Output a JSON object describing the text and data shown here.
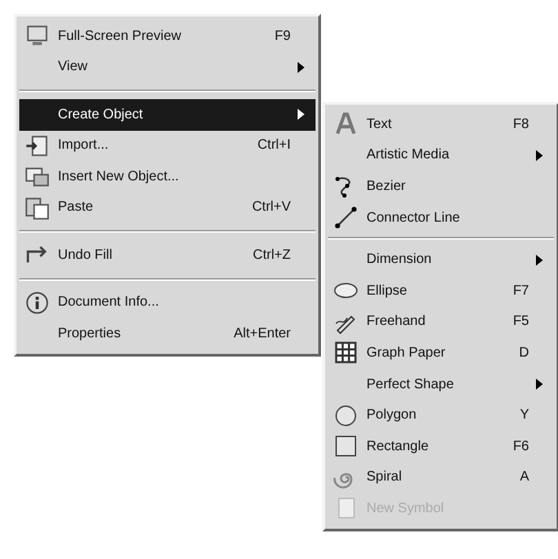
{
  "menu": {
    "items": [
      {
        "kind": "item",
        "label": "Full-Screen Preview",
        "shortcut": "F9",
        "submenu": false,
        "selected": false,
        "disabled": false
      },
      {
        "kind": "item",
        "label": "View",
        "submenu": true,
        "selected": false,
        "disabled": false
      },
      {
        "kind": "separator"
      },
      {
        "kind": "item",
        "label": "Create Object",
        "submenu": true,
        "selected": true,
        "disabled": false
      },
      {
        "kind": "item",
        "label": "Import...",
        "shortcut": "Ctrl+I",
        "submenu": false,
        "selected": false,
        "disabled": false
      },
      {
        "kind": "item",
        "label": "Insert New Object...",
        "submenu": false,
        "selected": false,
        "disabled": false
      },
      {
        "kind": "item",
        "label": "Paste",
        "shortcut": "Ctrl+V",
        "submenu": false,
        "selected": false,
        "disabled": false
      },
      {
        "kind": "separator"
      },
      {
        "kind": "item",
        "label": "Undo Fill",
        "shortcut": "Ctrl+Z",
        "submenu": false,
        "selected": false,
        "disabled": false
      },
      {
        "kind": "separator"
      },
      {
        "kind": "item",
        "label": "Document Info...",
        "submenu": false,
        "selected": false,
        "disabled": false
      },
      {
        "kind": "item",
        "label": "Properties",
        "shortcut": "Alt+Enter",
        "submenu": false,
        "selected": false,
        "disabled": false
      }
    ]
  },
  "submenu": {
    "items": [
      {
        "kind": "item",
        "label": "Text",
        "shortcut": "F8",
        "submenu": false,
        "disabled": false
      },
      {
        "kind": "item",
        "label": "Artistic Media",
        "submenu": true,
        "disabled": false
      },
      {
        "kind": "item",
        "label": "Bezier",
        "submenu": false,
        "disabled": false
      },
      {
        "kind": "item",
        "label": "Connector Line",
        "submenu": false,
        "disabled": false
      },
      {
        "kind": "separator"
      },
      {
        "kind": "item",
        "label": "Dimension",
        "submenu": true,
        "disabled": false
      },
      {
        "kind": "item",
        "label": "Ellipse",
        "shortcut": "F7",
        "submenu": false,
        "disabled": false
      },
      {
        "kind": "item",
        "label": "Freehand",
        "shortcut": "F5",
        "submenu": false,
        "disabled": false
      },
      {
        "kind": "item",
        "label": "Graph Paper",
        "shortcut": "D",
        "submenu": false,
        "disabled": false
      },
      {
        "kind": "item",
        "label": "Perfect Shape",
        "submenu": true,
        "disabled": false
      },
      {
        "kind": "item",
        "label": "Polygon",
        "shortcut": "Y",
        "submenu": false,
        "disabled": false
      },
      {
        "kind": "item",
        "label": "Rectangle",
        "shortcut": "F6",
        "submenu": false,
        "disabled": false
      },
      {
        "kind": "item",
        "label": "Spiral",
        "shortcut": "A",
        "submenu": false,
        "disabled": false
      },
      {
        "kind": "item",
        "label": "New Symbol",
        "submenu": false,
        "disabled": true
      }
    ]
  }
}
